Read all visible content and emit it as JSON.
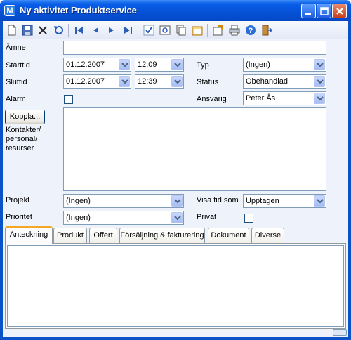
{
  "window": {
    "title": "Ny aktivitet Produktservice",
    "app_icon_letter": "M"
  },
  "form": {
    "subject_label": "Ämne",
    "subject_value": "",
    "start_label": "Starttid",
    "start_date": "01.12.2007",
    "start_time": "12:09",
    "end_label": "Sluttid",
    "end_date": "01.12.2007",
    "end_time": "12:39",
    "alarm_label": "Alarm",
    "type_label": "Typ",
    "type_value": "(Ingen)",
    "status_label": "Status",
    "status_value": "Obehandlad",
    "responsible_label": "Ansvarig",
    "responsible_value": "Peter Ås",
    "connect_button": "Koppla...",
    "contacts_label": "Kontakter/ personal/ resurser",
    "project_label": "Projekt",
    "project_value": "(Ingen)",
    "show_time_label": "Visa tid som",
    "show_time_value": "Upptagen",
    "priority_label": "Prioritet",
    "priority_value": "(Ingen)",
    "private_label": "Privat"
  },
  "tabs": [
    {
      "label": "Anteckning"
    },
    {
      "label": "Produkt"
    },
    {
      "label": "Offert"
    },
    {
      "label": "Försäljning & fakturering"
    },
    {
      "label": "Dokument"
    },
    {
      "label": "Diverse"
    }
  ],
  "icons": {
    "toolbar": [
      "new-icon",
      "save-icon",
      "delete-icon",
      "undo-icon",
      "first-record-icon",
      "previous-record-icon",
      "next-record-icon",
      "last-record-icon",
      "check-icon",
      "preview-icon",
      "copy-icon",
      "calendar-icon",
      "properties-icon",
      "print-icon",
      "help-icon",
      "exit-icon"
    ]
  },
  "colors": {
    "titlebar": "#0552d6",
    "client_bg": "#eef2fb",
    "active_tab_accent": "#f5a623"
  }
}
